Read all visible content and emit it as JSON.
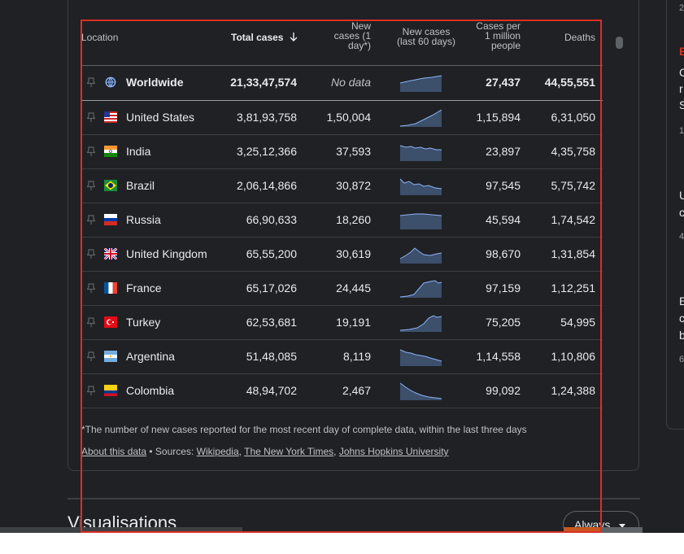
{
  "header": {
    "location": "Location",
    "total_cases": "Total cases",
    "new_cases": [
      "New",
      "cases (1",
      "day*)"
    ],
    "new_cases_60": [
      "New cases",
      "(last 60 days)"
    ],
    "cases_per_million": [
      "Cases per",
      "1 million",
      "people"
    ],
    "deaths": "Deaths"
  },
  "worldwide": {
    "location": "Worldwide",
    "total_cases": "21,33,47,574",
    "new_cases": "No data",
    "cases_per_million": "27,437",
    "deaths": "44,55,551"
  },
  "rows": [
    {
      "location": "United States",
      "total_cases": "3,81,93,758",
      "new_cases": "1,50,004",
      "cases_per_million": "1,15,894",
      "deaths": "6,31,050",
      "flag": "us-flag"
    },
    {
      "location": "India",
      "total_cases": "3,25,12,366",
      "new_cases": "37,593",
      "cases_per_million": "23,897",
      "deaths": "4,35,758",
      "flag": "india-flag"
    },
    {
      "location": "Brazil",
      "total_cases": "2,06,14,866",
      "new_cases": "30,872",
      "cases_per_million": "97,545",
      "deaths": "5,75,742",
      "flag": "brazil-flag"
    },
    {
      "location": "Russia",
      "total_cases": "66,90,633",
      "new_cases": "18,260",
      "cases_per_million": "45,594",
      "deaths": "1,74,542",
      "flag": "russia-flag"
    },
    {
      "location": "United Kingdom",
      "total_cases": "65,55,200",
      "new_cases": "30,619",
      "cases_per_million": "98,670",
      "deaths": "1,31,854",
      "flag": "uk-flag"
    },
    {
      "location": "France",
      "total_cases": "65,17,026",
      "new_cases": "24,445",
      "cases_per_million": "97,159",
      "deaths": "1,12,251",
      "flag": "france-flag"
    },
    {
      "location": "Turkey",
      "total_cases": "62,53,681",
      "new_cases": "19,191",
      "cases_per_million": "75,205",
      "deaths": "54,995",
      "flag": "turkey-flag"
    },
    {
      "location": "Argentina",
      "total_cases": "51,48,085",
      "new_cases": "8,119",
      "cases_per_million": "1,14,558",
      "deaths": "1,10,806",
      "flag": "argentina-flag"
    },
    {
      "location": "Colombia",
      "total_cases": "48,94,702",
      "new_cases": "2,467",
      "cases_per_million": "99,092",
      "deaths": "1,24,388",
      "flag": "colombia-flag"
    }
  ],
  "footnote": "*The number of new cases reported for the most recent day of complete data, within the last three days",
  "sources": {
    "about": "About this data",
    "prefix": " • Sources: ",
    "links": [
      "Wikipedia",
      "The New York Times",
      "Johns Hopkins University"
    ],
    "separator": ", "
  },
  "visualisations": {
    "title": "Visualisations",
    "button": "Always"
  },
  "side_texts": [
    "2",
    "B",
    "C",
    "r",
    "S",
    "1",
    "U",
    "c",
    "4",
    "E",
    "c",
    "b",
    "6"
  ],
  "colors": {
    "background": "#202124",
    "spark_fill": "#3c4f6b",
    "spark_line": "#8ab4f8",
    "selection": "#d93025"
  }
}
